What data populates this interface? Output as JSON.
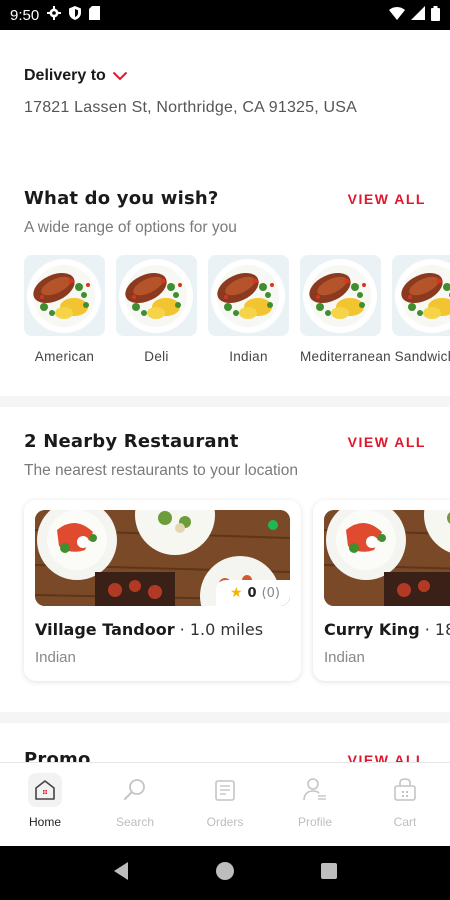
{
  "status_bar": {
    "time": "9:50"
  },
  "delivery": {
    "label": "Delivery to",
    "address": "17821 Lassen St, Northridge, CA 91325, USA"
  },
  "wish": {
    "title": "What do you wish?",
    "view_all": "VIEW ALL",
    "subtitle": "A wide range of options for you",
    "cuisines": [
      {
        "name": "American"
      },
      {
        "name": "Deli"
      },
      {
        "name": "Indian"
      },
      {
        "name": "Mediterranean"
      },
      {
        "name": "Sandwiches"
      }
    ]
  },
  "nearby": {
    "title": "2 Nearby Restaurant",
    "view_all": "VIEW ALL",
    "subtitle": "The nearest restaurants to your location",
    "restaurants": [
      {
        "name": "Village Tandoor",
        "distance": " · 1.0 miles",
        "cuisine": "Indian",
        "rating": "0",
        "rating_count": "(0)"
      },
      {
        "name": "Curry King",
        "distance": " · 18",
        "cuisine": "Indian"
      }
    ]
  },
  "promo": {
    "title": "Promo",
    "view_all": "VIEW ALL"
  },
  "bottom_nav": {
    "items": [
      {
        "label": "Home"
      },
      {
        "label": "Search"
      },
      {
        "label": "Orders"
      },
      {
        "label": "Profile"
      },
      {
        "label": "Cart"
      }
    ]
  },
  "colors": {
    "accent": "#e0182d",
    "open_status": "#1db954",
    "star": "#f5b400"
  }
}
